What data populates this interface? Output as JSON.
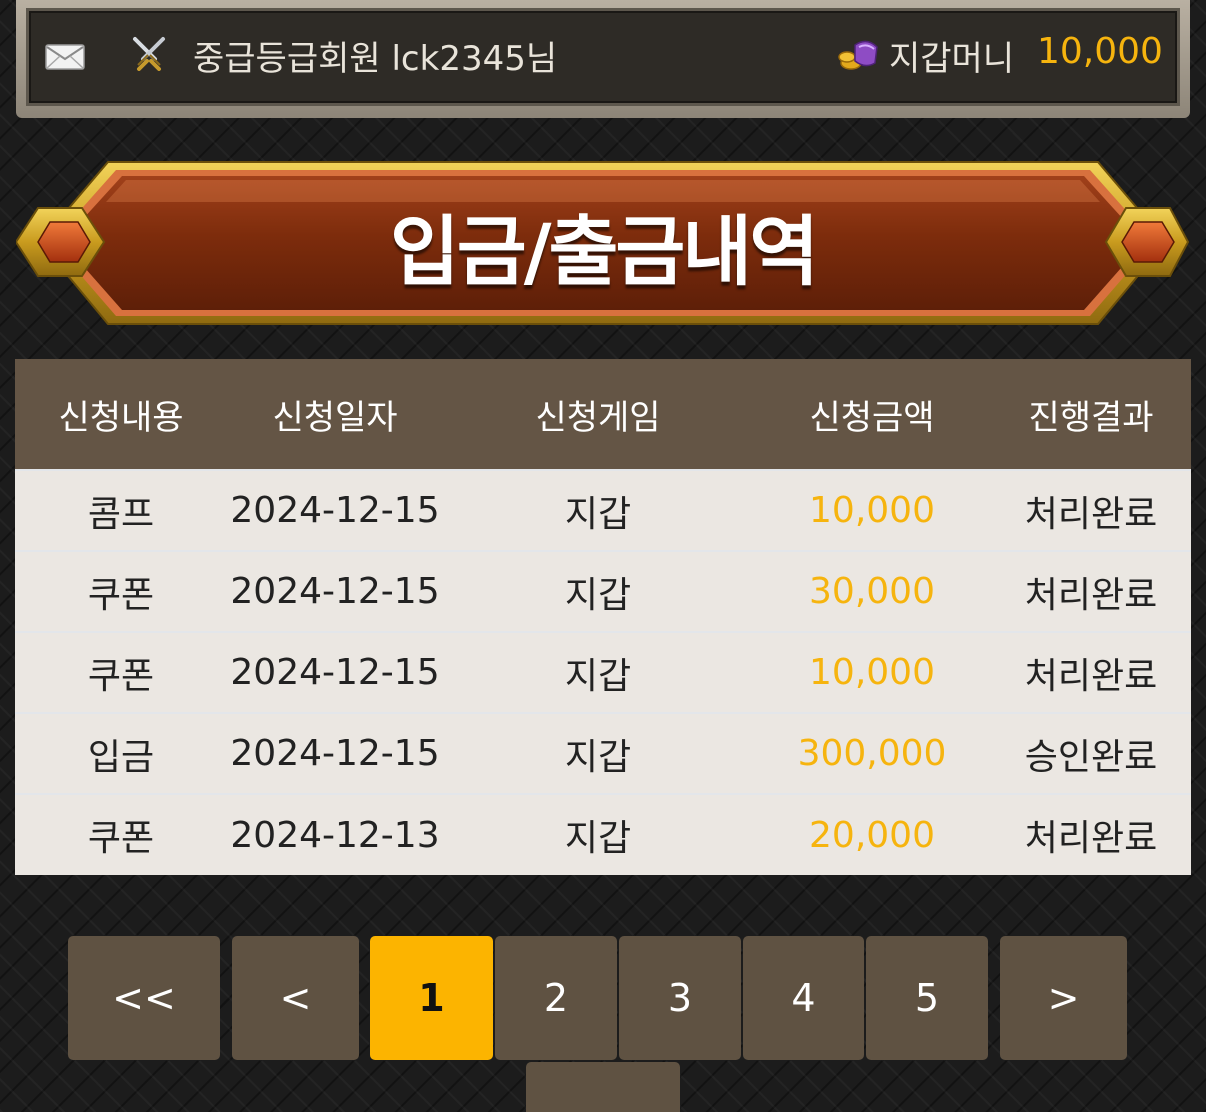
{
  "header": {
    "mail_icon": "mail-icon",
    "rank_icon": "crossed-swords-icon",
    "member_text": "중급등급회원 lck2345님",
    "wallet_icon": "coin-purse-icon",
    "wallet_label": "지갑머니",
    "wallet_amount": "10,000"
  },
  "banner": {
    "title": "입금/출금내역"
  },
  "table": {
    "headers": [
      "신청내용",
      "신청일자",
      "신청게임",
      "신청금액",
      "진행결과"
    ],
    "rows": [
      [
        "콤프",
        "2024-12-15",
        "지갑",
        "10,000",
        "처리완료"
      ],
      [
        "쿠폰",
        "2024-12-15",
        "지갑",
        "30,000",
        "처리완료"
      ],
      [
        "쿠폰",
        "2024-12-15",
        "지갑",
        "10,000",
        "처리완료"
      ],
      [
        "입금",
        "2024-12-15",
        "지갑",
        "300,000",
        "승인완료"
      ],
      [
        "쿠폰",
        "2024-12-13",
        "지갑",
        "20,000",
        "처리완료"
      ]
    ]
  },
  "pagination": {
    "first": "<<",
    "prev": "<",
    "pages": [
      "1",
      "2",
      "3",
      "4",
      "5"
    ],
    "current": "1",
    "next": ">"
  },
  "colors": {
    "accent": "#f6b40e",
    "header_bg": "#645545",
    "row_bg": "#ebe7e2",
    "banner_red": "#7d2c0c",
    "banner_gold": "#c79a1c"
  }
}
